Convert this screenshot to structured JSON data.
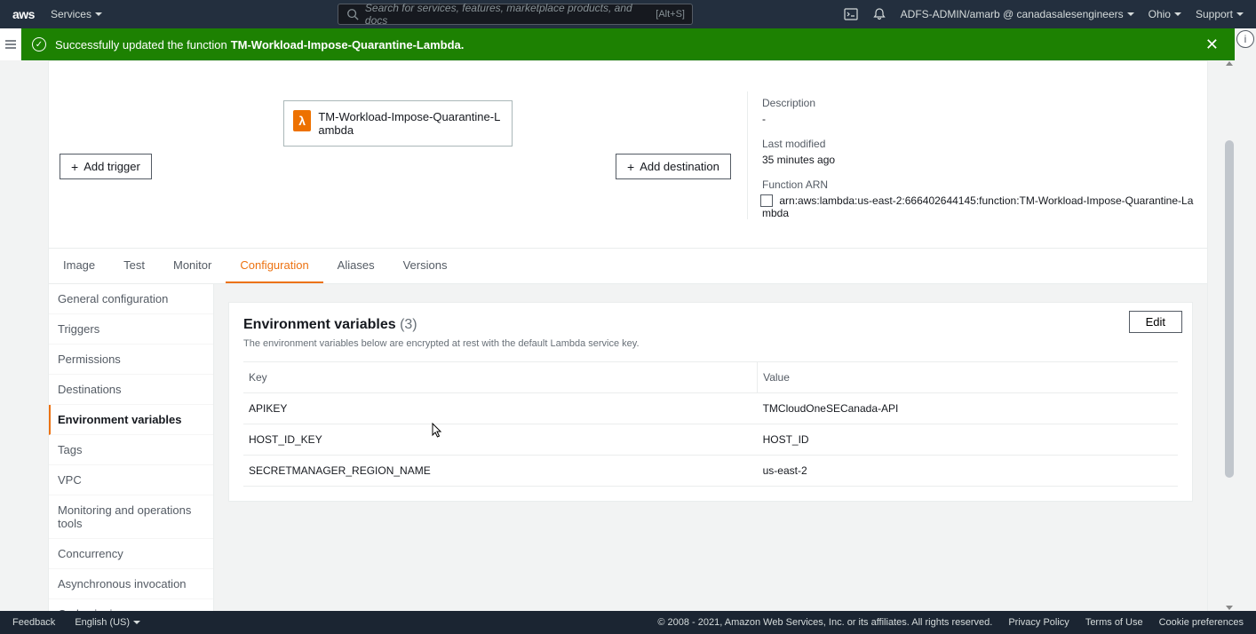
{
  "header": {
    "logo": "aws",
    "services": "Services",
    "search_placeholder": "Search for services, features, marketplace products, and docs",
    "search_shortcut": "[Alt+S]",
    "user": "ADFS-ADMIN/amarb @ canadasalesengineers",
    "region": "Ohio",
    "support": "Support"
  },
  "banner": {
    "prefix": "Successfully updated the function ",
    "fn_name": "TM-Workload-Impose-Quarantine-Lambda."
  },
  "overview": {
    "function_name": "TM-Workload-Impose-Quarantine-Lambda",
    "add_trigger": "Add trigger",
    "add_destination": "Add destination",
    "desc_label": "Description",
    "desc_value": "-",
    "modified_label": "Last modified",
    "modified_value": "35 minutes ago",
    "arn_label": "Function ARN",
    "arn_value": "arn:aws:lambda:us-east-2:666402644145:function:TM-Workload-Impose-Quarantine-Lambda"
  },
  "tabs": [
    "Image",
    "Test",
    "Monitor",
    "Configuration",
    "Aliases",
    "Versions"
  ],
  "active_tab": "Configuration",
  "sidebar_items": [
    "General configuration",
    "Triggers",
    "Permissions",
    "Destinations",
    "Environment variables",
    "Tags",
    "VPC",
    "Monitoring and operations tools",
    "Concurrency",
    "Asynchronous invocation",
    "Code signing"
  ],
  "active_sidebar": "Environment variables",
  "env": {
    "title": "Environment variables",
    "count": "(3)",
    "desc": "The environment variables below are encrypted at rest with the default Lambda service key.",
    "edit": "Edit",
    "col_key": "Key",
    "col_value": "Value",
    "rows": [
      {
        "k": "APIKEY",
        "v": "TMCloudOneSECanada-API"
      },
      {
        "k": "HOST_ID_KEY",
        "v": "HOST_ID"
      },
      {
        "k": "SECRETMANAGER_REGION_NAME",
        "v": "us-east-2"
      }
    ]
  },
  "footer": {
    "feedback": "Feedback",
    "language": "English (US)",
    "copyright": "© 2008 - 2021, Amazon Web Services, Inc. or its affiliates. All rights reserved.",
    "privacy": "Privacy Policy",
    "terms": "Terms of Use",
    "cookies": "Cookie preferences"
  }
}
